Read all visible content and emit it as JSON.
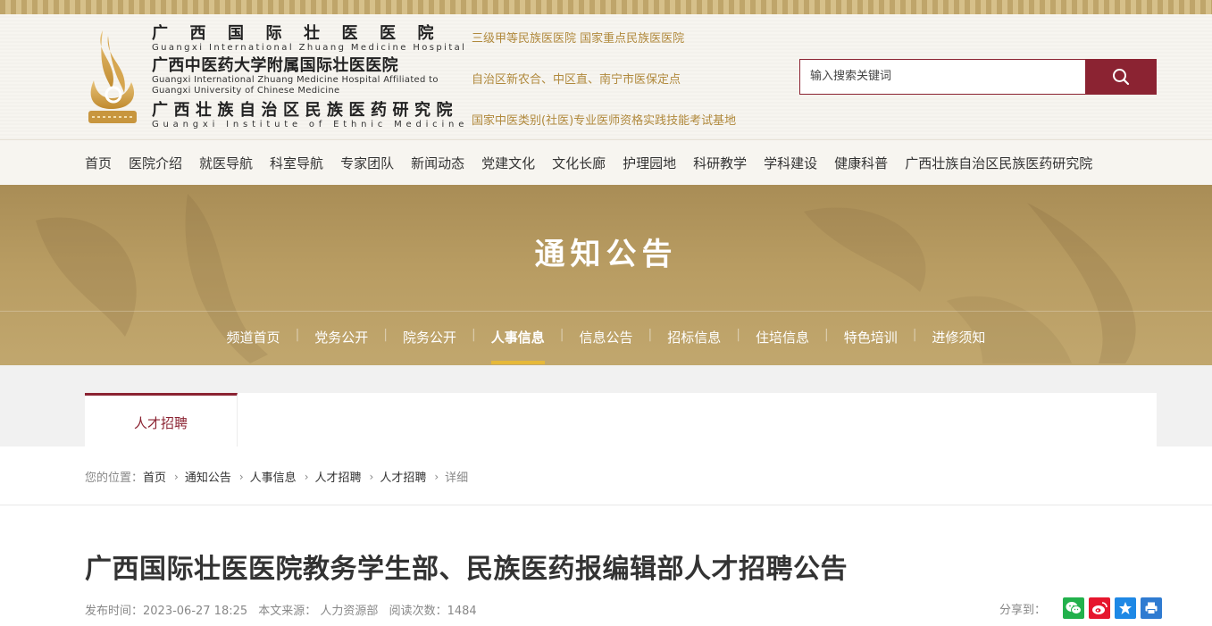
{
  "header": {
    "names": [
      {
        "cn": "广西国际壮医医院",
        "en": "Guangxi International Zhuang Medicine Hospital"
      },
      {
        "cn": "广西中医药大学附属国际壮医医院",
        "en1": "Guangxi International Zhuang Medicine Hospital Affiliated to",
        "en2": "Guangxi University of Chinese Medicine"
      },
      {
        "cn": "广西壮族自治区民族医药研究院",
        "en": "Guangxi Institute of Ethnic Medicine"
      }
    ],
    "tags": [
      "三级甲等民族医医院  国家重点民族医医院",
      "自治区新农合、中区直、南宁市医保定点",
      "国家中医类别(社医)专业医师资格实践技能考试基地"
    ],
    "search": {
      "placeholder": "输入搜索关键词"
    }
  },
  "nav": {
    "items": [
      "首页",
      "医院介绍",
      "就医导航",
      "科室导航",
      "专家团队",
      "新闻动态",
      "党建文化",
      "文化长廊",
      "护理园地",
      "科研教学",
      "学科建设",
      "健康科普",
      "广西壮族自治区民族医药研究院"
    ]
  },
  "banner": {
    "title": "通知公告",
    "subnav": [
      "频道首页",
      "党务公开",
      "院务公开",
      "人事信息",
      "信息公告",
      "招标信息",
      "住培信息",
      "特色培训",
      "进修须知"
    ],
    "active_index": 3
  },
  "tabs": {
    "active_label": "人才招聘"
  },
  "breadcrumb": {
    "label": "您的位置：",
    "items": [
      "首页",
      "通知公告",
      "人事信息",
      "人才招聘",
      "人才招聘",
      "详细"
    ]
  },
  "article": {
    "title": "广西国际壮医医院教务学生部、民族医药报编辑部人才招聘公告",
    "publish": "发布时间：2023-06-27 18:25",
    "source": "本文来源： 人力资源部",
    "reads": "阅读次数：1484"
  },
  "share": {
    "label": "分享到：",
    "buttons": [
      {
        "icon": "wechat-icon",
        "color": "#22b14c"
      },
      {
        "icon": "weibo-icon",
        "color": "#e6162d"
      },
      {
        "icon": "qzone-icon",
        "color": "#1e88e5"
      },
      {
        "icon": "print-icon",
        "color": "#2f7bd1"
      }
    ]
  },
  "colors": {
    "brand": "#8b2332",
    "gold": "#b0893c",
    "banner": "#b89c62",
    "active_underline": "#e6b93a"
  }
}
